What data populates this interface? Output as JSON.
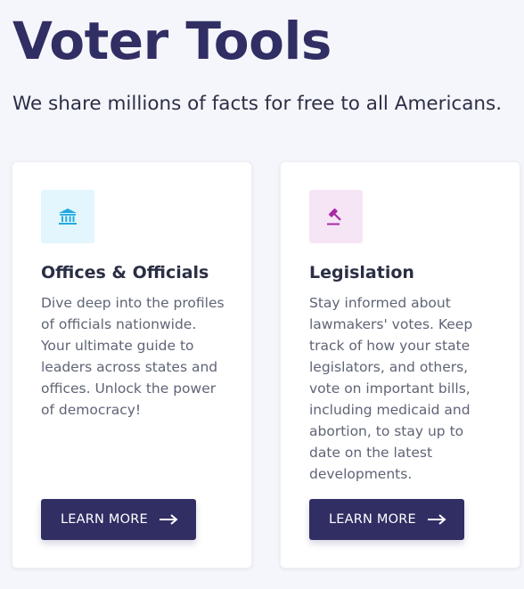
{
  "header": {
    "title": "Voter Tools",
    "subtitle": "We share millions of facts for free to all Americans."
  },
  "cards": [
    {
      "title": "Offices & Officials",
      "description": "Dive deep into the profiles of officials nationwide. Your ultimate guide to leaders across states and offices. Unlock the power of democracy!",
      "button_label": "LEARN MORE",
      "icon": "government-building-icon",
      "icon_color": "#22a9e0",
      "icon_bg": "#e3f6fd"
    },
    {
      "title": "Legislation",
      "description": "Stay informed about lawmakers' votes. Keep track of how your state legislators, and others, vote on important bills, including medicaid and abortion, to stay up to date on the latest developments.",
      "button_label": "LEARN MORE",
      "icon": "gavel-icon",
      "icon_color": "#a62ba3",
      "icon_bg": "#f6e5f5"
    }
  ],
  "colors": {
    "primary": "#312e64",
    "background": "#f5f6fb"
  }
}
